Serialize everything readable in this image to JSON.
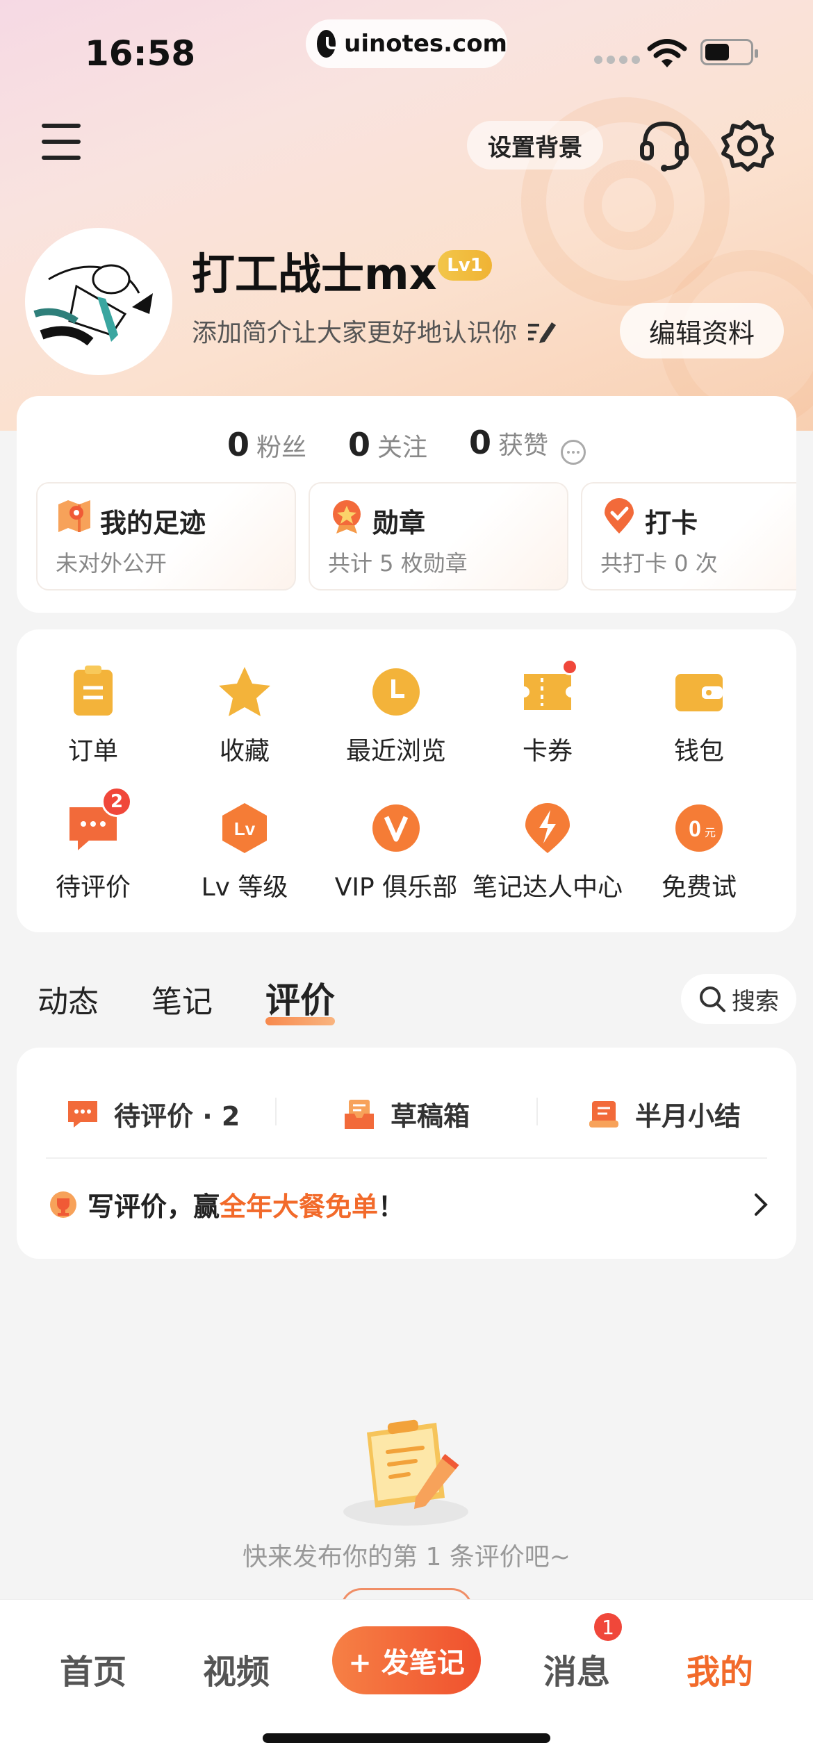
{
  "status_bar": {
    "time": "16:58",
    "url": "uinotes.com"
  },
  "header": {
    "bg_button": "设置背景"
  },
  "profile": {
    "name": "打工战士mx",
    "level": "Lv1",
    "bio": "添加简介让大家更好地认识你",
    "edit_button": "编辑资料"
  },
  "stats": [
    {
      "num": "0",
      "label": "粉丝"
    },
    {
      "num": "0",
      "label": "关注"
    },
    {
      "num": "0",
      "label": "获赞"
    }
  ],
  "cards": [
    {
      "title": "我的足迹",
      "sub": "未对外公开"
    },
    {
      "title": "勋章",
      "sub": "共计 5 枚勋章"
    },
    {
      "title": "打卡",
      "sub": "共打卡 0 次"
    }
  ],
  "grid": [
    {
      "label": "订单",
      "icon": "clipboard-icon"
    },
    {
      "label": "收藏",
      "icon": "star-icon"
    },
    {
      "label": "最近浏览",
      "icon": "clock-icon"
    },
    {
      "label": "卡券",
      "icon": "coupon-icon"
    },
    {
      "label": "钱包",
      "icon": "wallet-icon"
    },
    {
      "label": "待评价",
      "icon": "chat-bubble-icon",
      "badge": "2"
    },
    {
      "label": "Lv 等级",
      "icon": "level-hexagon-icon"
    },
    {
      "label": "VIP 俱乐部",
      "icon": "vip-icon"
    },
    {
      "label": "笔记达人中心",
      "icon": "lightning-icon"
    },
    {
      "label": "免费试",
      "icon": "free-trial-icon"
    }
  ],
  "tabs": [
    "动态",
    "笔记",
    "评价"
  ],
  "search_label": "搜索",
  "review": {
    "items": [
      "待评价 · 2",
      "草稿箱",
      "半月小结"
    ],
    "promo_prefix": "写评价，赢",
    "promo_highlight": "全年大餐免单",
    "promo_suffix": "！"
  },
  "empty_text": "快来发布你的第 1 条评价吧~",
  "tabbar": {
    "home": "首页",
    "video": "视频",
    "post": "+ 发笔记",
    "messages": "消息",
    "messages_badge": "1",
    "mine": "我的"
  },
  "colors": {
    "accent": "#f26a2a",
    "badge": "#f0473a",
    "icon_gold": "#f3b33a"
  }
}
